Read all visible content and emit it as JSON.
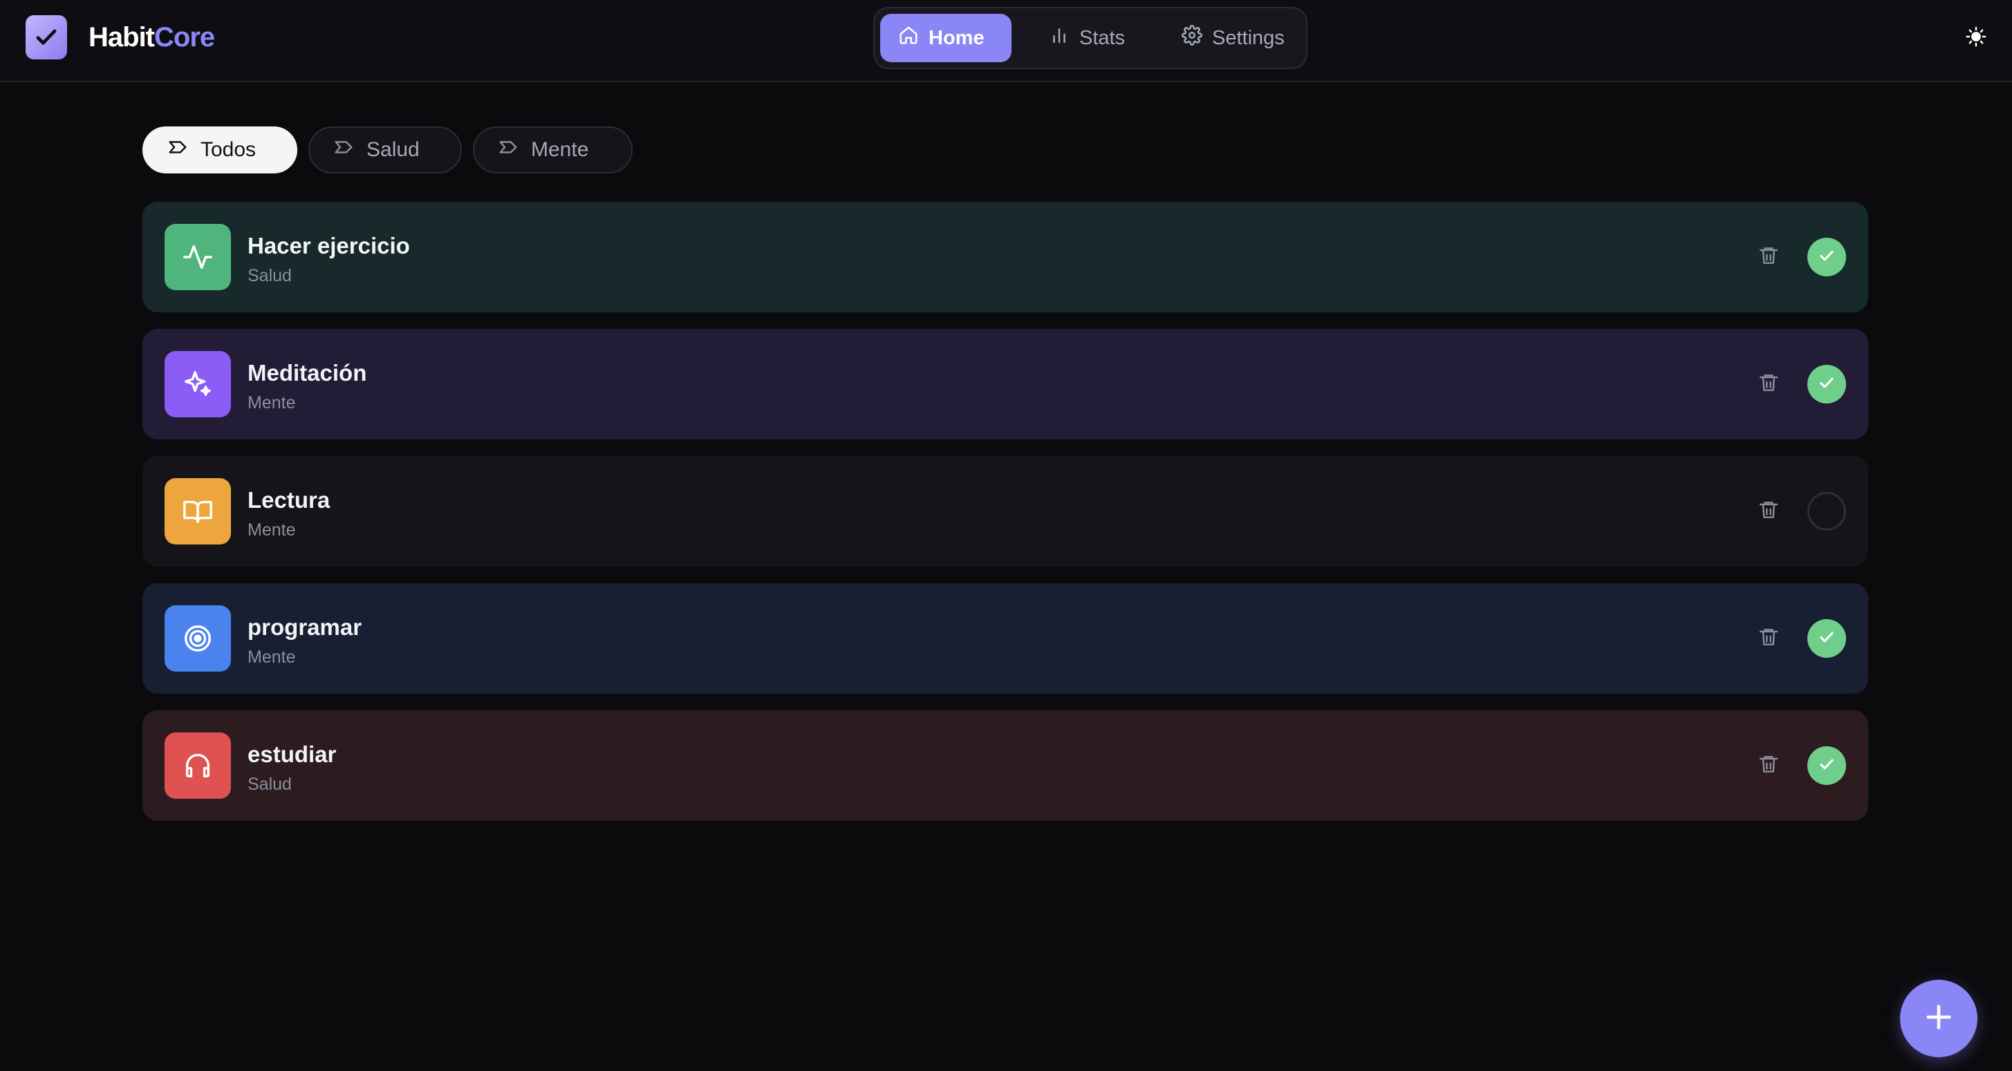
{
  "app": {
    "name_part1": "Habit",
    "name_part2": "Core",
    "accent_color": "#8b86f5"
  },
  "nav": {
    "items": [
      {
        "label": "Home",
        "icon": "home-icon",
        "active": true
      },
      {
        "label": "Stats",
        "icon": "bar-chart-icon",
        "active": false
      },
      {
        "label": "Settings",
        "icon": "gear-icon",
        "active": false
      }
    ]
  },
  "theme_toggle": {
    "icon": "sun-icon"
  },
  "filters": [
    {
      "label": "Todos",
      "icon": "tag-icon",
      "active": true
    },
    {
      "label": "Salud",
      "icon": "tag-icon",
      "active": false
    },
    {
      "label": "Mente",
      "icon": "tag-icon",
      "active": false
    }
  ],
  "habits": [
    {
      "name": "Hacer ejercicio",
      "category": "Salud",
      "icon": "activity-icon",
      "icon_color": "#4fb57c",
      "card_color": "#17292a",
      "completed": true
    },
    {
      "name": "Meditación",
      "category": "Mente",
      "icon": "sparkles-icon",
      "icon_color": "#8b5cf6",
      "card_color": "#221c36",
      "completed": true
    },
    {
      "name": "Lectura",
      "category": "Mente",
      "icon": "book-open-icon",
      "icon_color": "#eda63d",
      "card_color": "#151519",
      "completed": false
    },
    {
      "name": "programar",
      "category": "Mente",
      "icon": "target-icon",
      "icon_color": "#4a82ee",
      "card_color": "#181f33",
      "completed": true
    },
    {
      "name": "estudiar",
      "category": "Salud",
      "icon": "headphones-icon",
      "icon_color": "#e05151",
      "card_color": "#2c1c20",
      "completed": true
    }
  ],
  "fab": {
    "icon": "plus-icon"
  }
}
